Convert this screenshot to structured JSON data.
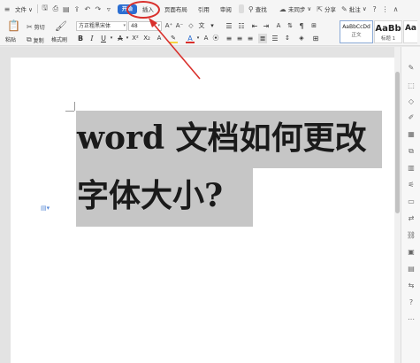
{
  "menubar": {
    "items": [
      {
        "name": "menu-icon",
        "label": "≡"
      },
      {
        "name": "file-menu",
        "label": "文件 ∨"
      }
    ],
    "tabs": [
      "开始",
      "插入",
      "页面布局",
      "引用",
      "审阅"
    ],
    "search_label": "查找",
    "sync_label": "未同步",
    "share_label": "分享",
    "comment_label": "批注"
  },
  "ribbon": {
    "paste_label": "粘贴",
    "cut_label": "剪切",
    "copy_label": "复制",
    "format_painter_label": "格式刷",
    "font_name": "方正粗黑宋体",
    "font_size": "48",
    "styles": [
      {
        "preview": "AaBbCcDd",
        "label": "正文"
      },
      {
        "preview": "AaBb",
        "label": "标题 1"
      },
      {
        "preview": "Aa",
        "label": ""
      }
    ],
    "colors": {
      "accent": "#2b6ed2",
      "font_color_bar": "#d9302c",
      "highlight_bar": "#f5d442"
    }
  },
  "document": {
    "line1": "word 文档如何更改",
    "line2": "字体大小?"
  },
  "annotation_color": "#d9302c"
}
